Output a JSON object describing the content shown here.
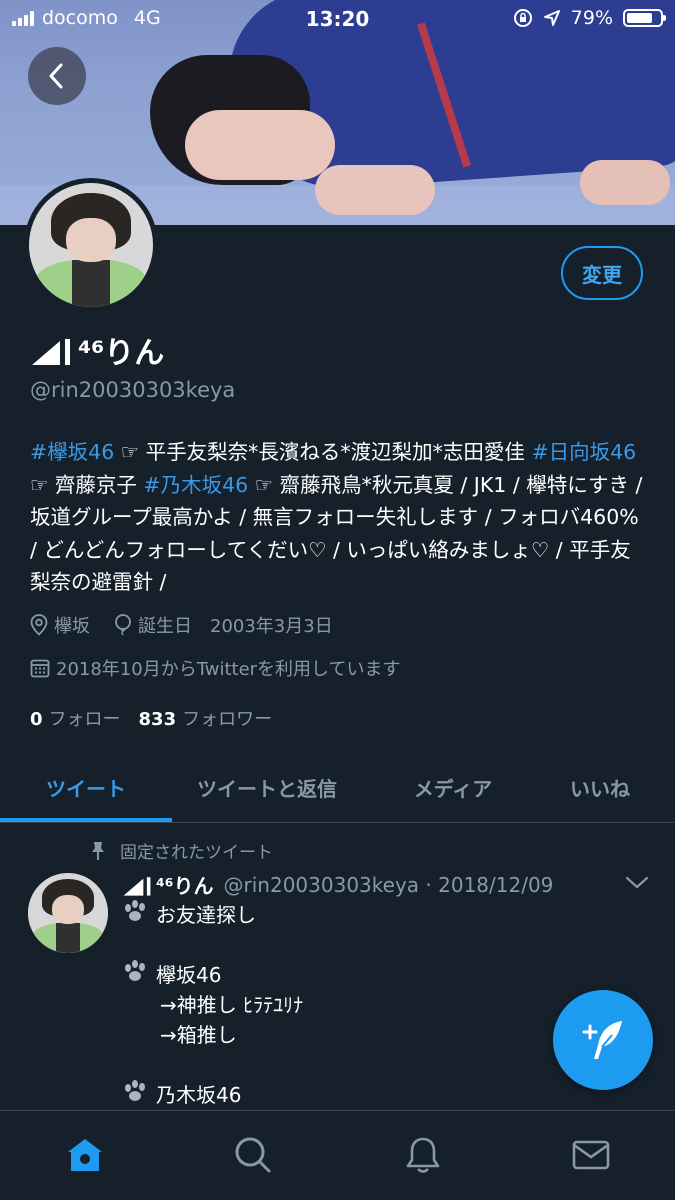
{
  "status_bar": {
    "carrier": "docomo",
    "network": "4G",
    "time": "13:20",
    "battery_text": "79%",
    "battery_level": 0.79
  },
  "profile": {
    "edit_label": "変更",
    "name_suffix": "⁴⁶りん",
    "handle": "@rin20030303keya",
    "bio": [
      {
        "text": "#欅坂46",
        "tag": true
      },
      {
        "text": " ☞ 平手友梨奈*長濱ねる*渡辺梨加*志田愛佳 ",
        "tag": false
      },
      {
        "text": "#日向坂46",
        "tag": true
      },
      {
        "text": " ☞ 齊藤京子 ",
        "tag": false
      },
      {
        "text": "#乃木坂46",
        "tag": true
      },
      {
        "text": " ☞ 齋藤飛鳥*秋元真夏 / JK1 / 欅特にすき / 坂道グループ最高かよ / 無言フォロー失礼します / フォロバ460% / どんどんフォローしてくだい♡ / いっぱい絡みましょ♡ / 平手友梨奈の避雷針 /",
        "tag": false
      }
    ],
    "location": "欅坂",
    "birthday_label": "誕生日",
    "birthday": "2003年3月3日",
    "joined": "2018年10月からTwitterを利用しています",
    "following_count": "0",
    "following_label": "フォロー",
    "followers_count": "833",
    "followers_label": "フォロワー"
  },
  "tabs": [
    {
      "label": "ツイート",
      "active": true
    },
    {
      "label": "ツイートと返信",
      "active": false
    },
    {
      "label": "メディア",
      "active": false
    },
    {
      "label": "いいね",
      "active": false
    }
  ],
  "pinned_tweet": {
    "pin_label": "固定されたツイート",
    "name_suffix": "⁴⁶りん",
    "handle_date": "@rin20030303keya · 2018/12/09",
    "lines": [
      {
        "paw": true,
        "text": "お友達探し",
        "indent": false
      },
      {
        "paw": false,
        "text": "",
        "indent": false
      },
      {
        "paw": true,
        "text": "欅坂46",
        "indent": false
      },
      {
        "paw": false,
        "text": "→神推し ﾋﾗﾃﾕﾘﾅ",
        "indent": true
      },
      {
        "paw": false,
        "text": "→箱推し",
        "indent": true
      },
      {
        "paw": false,
        "text": "",
        "indent": false
      },
      {
        "paw": true,
        "text": "乃木坂46",
        "indent": false
      }
    ]
  },
  "icons": {
    "back": "chevron-left-icon",
    "location": "map-pin-icon",
    "birthday": "balloon-icon",
    "joined": "calendar-icon",
    "pin": "pin-icon",
    "more": "chevron-down-icon",
    "compose": "compose-feather-icon",
    "nav": [
      "home-icon",
      "search-icon",
      "bell-icon",
      "mail-icon"
    ]
  },
  "colors": {
    "background": "#15202b",
    "accent": "#1d9bf0",
    "hashtag": "#3b99e6",
    "muted": "#8899a6",
    "divider": "#38444d"
  }
}
